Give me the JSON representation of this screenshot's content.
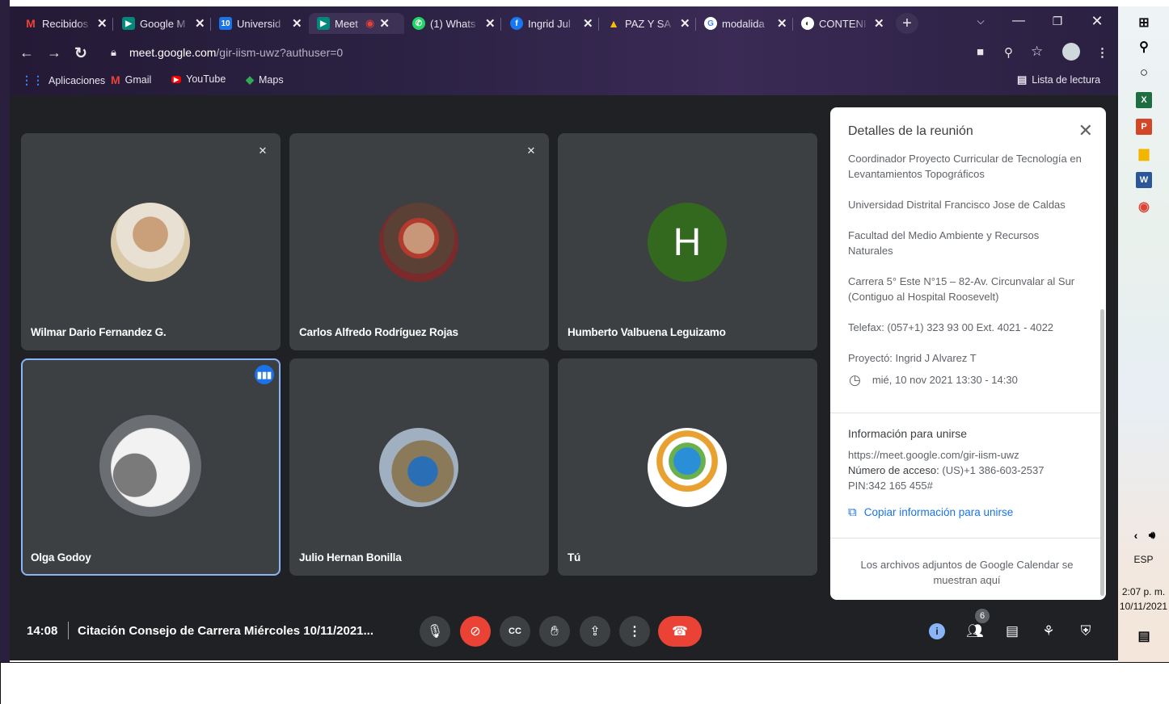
{
  "browser": {
    "tabs": [
      {
        "label": "Recibidos",
        "icon": "gmail-icon"
      },
      {
        "label": "Google M",
        "icon": "meet-icon"
      },
      {
        "label": "Universid",
        "icon": "calendar-icon"
      },
      {
        "label": "Meet",
        "icon": "meet-icon"
      },
      {
        "label": "(1) Whats",
        "icon": "whatsapp-icon"
      },
      {
        "label": "Ingrid Jul",
        "icon": "facebook-icon"
      },
      {
        "label": "PAZ Y SA",
        "icon": "drive-icon"
      },
      {
        "label": "modalida",
        "icon": "google-icon"
      },
      {
        "label": "CONTENI",
        "icon": "globe-icon"
      }
    ],
    "url_host": "meet.google.com",
    "url_path": "/gir-iism-uwz?authuser=0",
    "bookmarks": [
      "Aplicaciones",
      "Gmail",
      "YouTube",
      "Maps"
    ],
    "reading_list": "Lista de lectura"
  },
  "participants": [
    {
      "name": "Wilmar Dario Fernandez G.",
      "muted": true
    },
    {
      "name": "Carlos Alfredo Rodríguez Rojas",
      "muted": true
    },
    {
      "name": "Humberto Valbuena Leguizamo",
      "initial": "H"
    },
    {
      "name": "Olga Godoy",
      "speaking": true
    },
    {
      "name": "Julio Hernan Bonilla"
    },
    {
      "name": "Tú"
    }
  ],
  "details": {
    "title": "Detalles de la reunión",
    "lines": [
      "Coordinador Proyecto Curricular de Tecnología en Levantamientos Topográficos",
      "Universidad Distrital Francisco Jose de Caldas",
      "Facultad del Medio Ambiente y Recursos Naturales",
      "Carrera 5° Este N°15 – 82-Av. Circunvalar al Sur (Contiguo al Hospital Roosevelt)",
      "Telefax: (057+1) 323 93 00 Ext. 4021 - 4022",
      "Proyectó: Ingrid J Alvarez T"
    ],
    "datetime": "mié, 10 nov 2021 13:30 - 14:30",
    "join_heading": "Información para unirse",
    "join_url": "https://meet.google.com/gir-iism-uwz",
    "dial_label": "Número de acceso:",
    "dial_number": "(US)+1 386-603-2537",
    "pin": "PIN:342 165 455#",
    "copy_label": "Copiar información para unirse",
    "attachments": "Los archivos adjuntos de Google Calendar se muestran aquí"
  },
  "bottom_bar": {
    "time": "14:08",
    "meeting_title": "Citación Consejo de Carrera Miércoles 10/11/2021...",
    "people_count": "6"
  },
  "taskbar": {
    "language": "ESP",
    "time": "2:07 p. m.",
    "date": "10/11/2021"
  },
  "colors": {
    "meet_bg": "#202124",
    "tile_bg": "#3c4043",
    "accent_blue": "#1a73e8",
    "leave_red": "#ea4335",
    "avatar_h": "#33691e"
  }
}
